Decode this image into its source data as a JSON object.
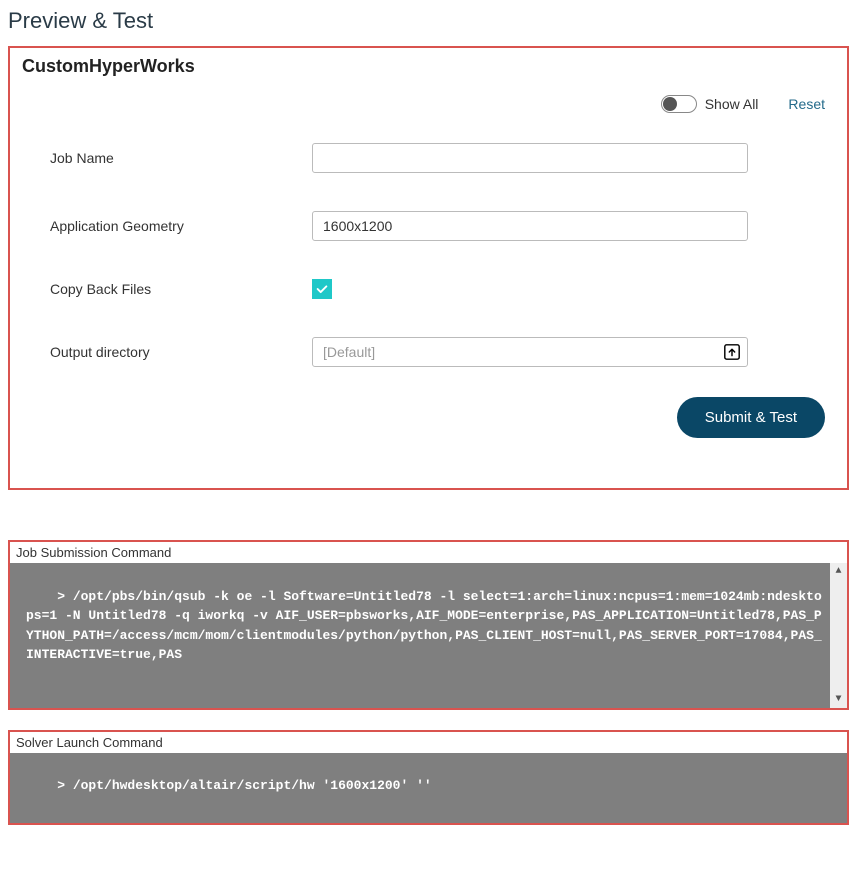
{
  "page_title": "Preview & Test",
  "form": {
    "title": "CustomHyperWorks",
    "show_all_label": "Show All",
    "reset_label": "Reset",
    "fields": {
      "job_name": {
        "label": "Job Name",
        "value": ""
      },
      "app_geometry": {
        "label": "Application Geometry",
        "value": "1600x1200"
      },
      "copy_back": {
        "label": "Copy Back Files",
        "checked": true
      },
      "output_dir": {
        "label": "Output directory",
        "placeholder": "[Default]"
      }
    },
    "submit_label": "Submit & Test"
  },
  "job_submission": {
    "title": "Job Submission Command",
    "command": "> /opt/pbs/bin/qsub -k oe -l Software=Untitled78 -l select=1:arch=linux:ncpus=1:mem=1024mb:ndesktops=1 -N Untitled78 -q iworkq -v AIF_USER=pbsworks,AIF_MODE=enterprise,PAS_APPLICATION=Untitled78,PAS_PYTHON_PATH=/access/mcm/mom/clientmodules/python/python,PAS_CLIENT_HOST=null,PAS_SERVER_PORT=17084,PAS_INTERACTIVE=true,PAS"
  },
  "solver_launch": {
    "title": "Solver Launch Command",
    "command": "> /opt/hwdesktop/altair/script/hw '1600x1200' ''"
  }
}
